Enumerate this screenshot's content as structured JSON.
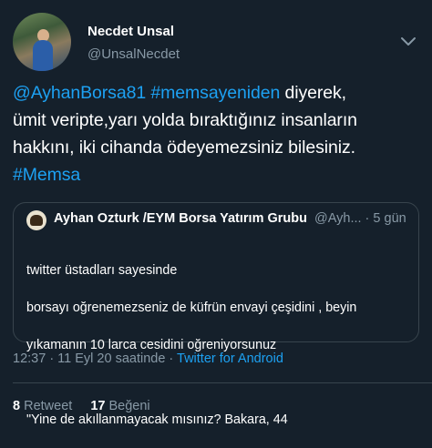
{
  "author": {
    "display_name": "Necdet Unsal",
    "handle": "@UnsalNecdet"
  },
  "tweet": {
    "mention": "@AyhanBorsa81",
    "hashtag1": "#memsayeniden",
    "text_line1_rest": " diyerek,",
    "text_line2": "ümit veripte,yarı yolda bıraktığınız insanların",
    "text_line3": "hakkını, iki cihanda ödeyemezsiniz bilesiniz.",
    "hashtag2": "#Memsa"
  },
  "quoted_tweet": {
    "display_name": "Ayhan Ozturk /EYM Borsa Yatırım Grubu",
    "handle_time": "@Ayh... · 5 gün",
    "lines": [
      "twitter üstadları sayesinde",
      "borsayı oğrenemezseniz de küfrün envayi çeşidini , beyin",
      "yıkamanın 10 larca cesidini oğreniyorsunuz",
      "",
      " \"Yine de akıllanmayacak mısınız? Bakara, 44"
    ]
  },
  "meta": {
    "time_date": "12:37 · 11 Eyl 20 saatinde · ",
    "source": "Twitter for Android"
  },
  "stats": {
    "retweet_count": "8",
    "retweet_label": "Retweet",
    "like_count": "17",
    "like_label": "Beğeni"
  },
  "colors": {
    "background": "#15202b",
    "link": "#1da1f2",
    "secondary_text": "#8899a6",
    "border": "#38444d"
  },
  "icons": {
    "more": "chevron-down-icon"
  }
}
